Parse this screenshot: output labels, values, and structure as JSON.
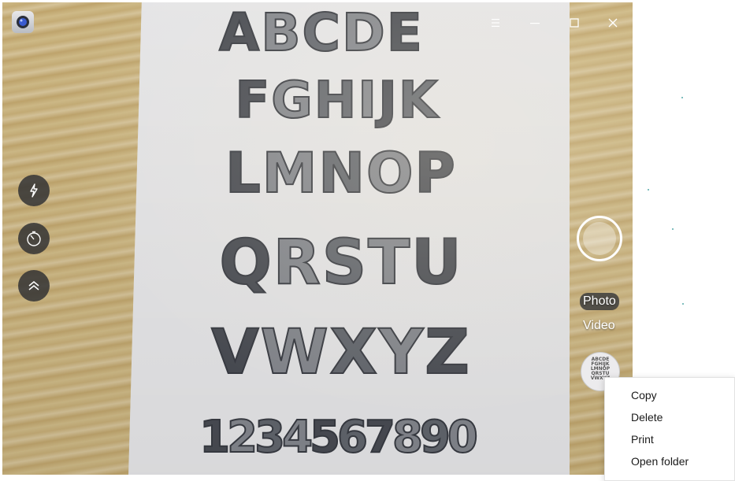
{
  "title_bar": {
    "app_icon": "camera-app-icon",
    "buttons": [
      "menu-icon",
      "minimize-icon",
      "maximize-icon",
      "close-icon"
    ]
  },
  "viewfinder": {
    "rows": [
      "ABCDE",
      "FGHIJK",
      "LMNOP",
      "QRSTU",
      "VWXYZ",
      "1234567890"
    ]
  },
  "left_controls": [
    "flash-icon",
    "timer-icon",
    "expand-up-icon"
  ],
  "modes": {
    "photo": "Photo",
    "video": "Video",
    "selected": "Photo"
  },
  "thumbnail": {
    "lines": [
      "ABCDE",
      "FGHIJK",
      "LMNOP",
      "QRSTU",
      "VWXYZ"
    ]
  },
  "context_menu": {
    "items": [
      "Copy",
      "Delete",
      "Print",
      "Open folder"
    ]
  }
}
